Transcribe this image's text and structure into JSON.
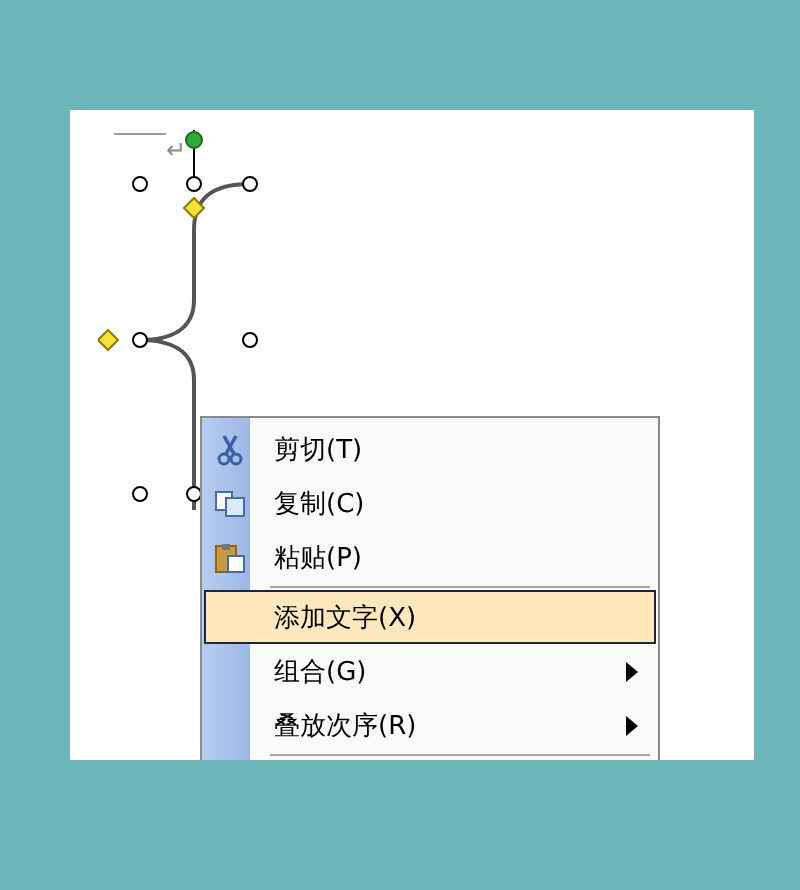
{
  "document": {
    "paragraph_mark": "↵"
  },
  "context_menu": {
    "items": [
      {
        "kind": "cut",
        "label": "剪切(T)",
        "selected": false,
        "submenu": false
      },
      {
        "kind": "copy",
        "label": "复制(C)",
        "selected": false,
        "submenu": false
      },
      {
        "kind": "paste",
        "label": "粘贴(P)",
        "selected": false,
        "submenu": false
      },
      {
        "kind": "separator"
      },
      {
        "kind": "plain",
        "label": "添加文字(X)",
        "selected": true,
        "submenu": false
      },
      {
        "kind": "plain",
        "label": "组合(G)",
        "selected": false,
        "submenu": true
      },
      {
        "kind": "plain",
        "label": "叠放次序(R)",
        "selected": false,
        "submenu": true
      },
      {
        "kind": "separator"
      }
    ]
  }
}
